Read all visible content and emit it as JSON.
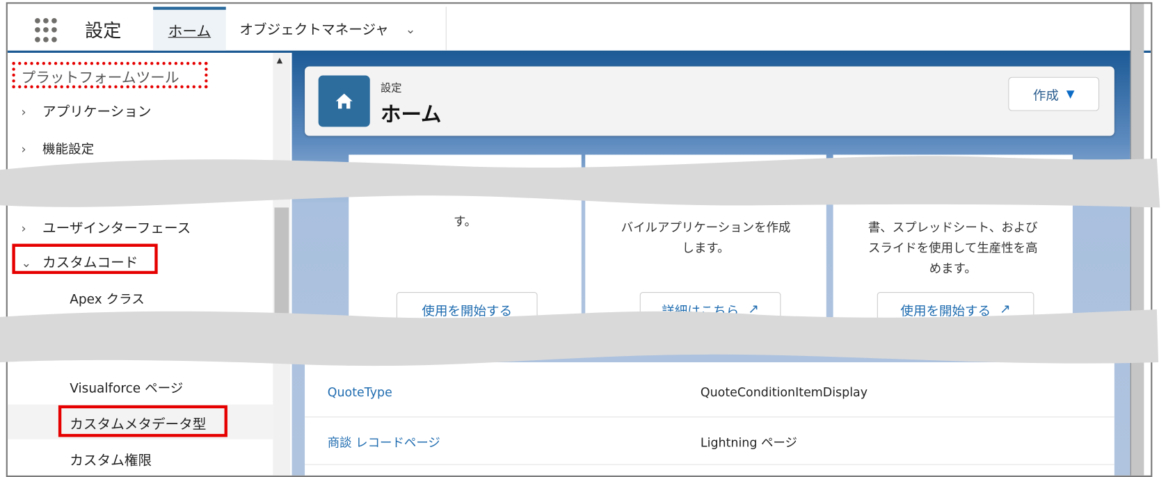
{
  "header": {
    "app_launcher_icon": "app-launcher-grid-icon",
    "app_title": "設定",
    "tabs": [
      {
        "label": "ホーム",
        "active": true
      },
      {
        "label": "オブジェクトマネージャ",
        "has_dropdown": true
      }
    ]
  },
  "sidebar": {
    "section_title": "プラットフォームツール",
    "items": [
      {
        "label": "アプリケーション",
        "expanded": false
      },
      {
        "label": "機能設定",
        "expanded": false
      },
      {
        "label": "ユーザインターフェース",
        "expanded": false
      },
      {
        "label": "カスタムコード",
        "expanded": true
      }
    ],
    "custom_code_children": [
      {
        "label": "Apex クラス"
      },
      {
        "label": "Visualforce ページ"
      },
      {
        "label": "カスタムメタデータ型",
        "selected": true
      },
      {
        "label": "カスタム権限"
      }
    ]
  },
  "page_header": {
    "breadcrumb": "設定",
    "title": "ホーム",
    "icon": "home-icon",
    "create_button": "作成"
  },
  "cards": [
    {
      "text_lines": [
        "す。"
      ],
      "button": "使用を開始する",
      "external": false
    },
    {
      "text_lines": [
        "バイルアプリケーションを作成",
        "します。"
      ],
      "button": "詳細はこちら",
      "external": true
    },
    {
      "text_lines": [
        "書、スプレッドシート、および",
        "スライドを使用して生産性を高",
        "めます。"
      ],
      "button": "使用を開始する",
      "external": true
    }
  ],
  "table": {
    "rows": [
      {
        "name": "QuoteType",
        "type": "QuoteConditionItemDisplay"
      },
      {
        "name": "商談 レコードページ",
        "type": "Lightning ページ"
      }
    ]
  },
  "colors": {
    "highlight_red": "#e60000",
    "brand_blue": "#1c5a94",
    "link_blue": "#1f6cb0",
    "tear_gray": "#d9d9d9"
  }
}
